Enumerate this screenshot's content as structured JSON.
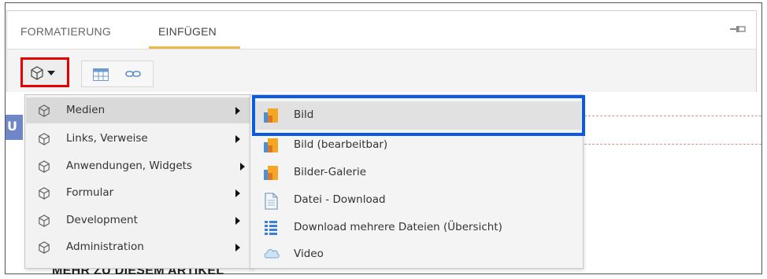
{
  "ribbon": {
    "tabs": [
      {
        "label": "FORMATIERUNG"
      },
      {
        "label": "EINFÜGEN"
      }
    ],
    "pin_icon": "pin-icon",
    "insert_icon": "cube-icon"
  },
  "background": {
    "heading": "MEHR ZU DIESEM ARTIKEL",
    "blue_glyph": "U"
  },
  "menu": {
    "items": [
      {
        "label": "Medien",
        "icon": "cube-icon",
        "submenu": true
      },
      {
        "label": "Links, Verweise",
        "icon": "cube-icon",
        "submenu": true
      },
      {
        "label": "Anwendungen, Widgets",
        "icon": "cube-icon",
        "submenu": true
      },
      {
        "label": "Formular",
        "icon": "cube-icon",
        "submenu": true
      },
      {
        "label": "Development",
        "icon": "cube-icon",
        "submenu": true
      },
      {
        "label": "Administration",
        "icon": "cube-icon",
        "submenu": true
      }
    ]
  },
  "submenu": {
    "items": [
      {
        "label": "Bild",
        "icon": "image-icon"
      },
      {
        "label": "Bild (bearbeitbar)",
        "icon": "image-icon"
      },
      {
        "label": "Bilder-Galerie",
        "icon": "image-icon"
      },
      {
        "label": "Datei - Download",
        "icon": "file-icon"
      },
      {
        "label": "Download mehrere Dateien (Übersicht)",
        "icon": "file-list-icon"
      },
      {
        "label": "Video",
        "icon": "cloud-icon"
      }
    ]
  },
  "colors": {
    "tab_underline": "#f0b84a",
    "insert_button_outline": "#e60000",
    "selection_outline": "#0a5be0",
    "image_icon_orange": "#f5a623",
    "image_icon_blue": "#4a8fd8"
  }
}
